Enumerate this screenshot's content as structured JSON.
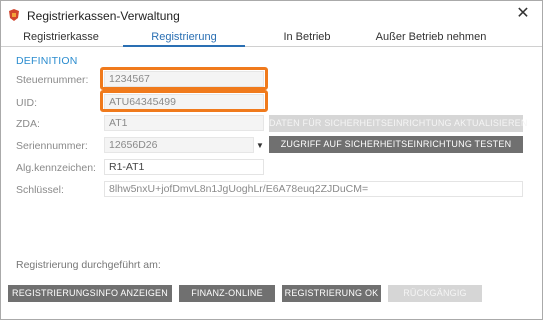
{
  "window": {
    "title": "Registrierkassen-Verwaltung",
    "close_glyph": "✕"
  },
  "tabs": [
    {
      "label": "Registrierkasse",
      "active": false
    },
    {
      "label": "Registrierung",
      "active": true
    },
    {
      "label": "In Betrieb",
      "active": false
    },
    {
      "label": "Außer Betrieb nehmen",
      "active": false
    }
  ],
  "definition": {
    "section_title": "DEFINITION",
    "steuernummer_label": "Steuernummer:",
    "steuernummer_value": "1234567",
    "uid_label": "UID:",
    "uid_value": "ATU64345499",
    "zda_label": "ZDA:",
    "zda_value": "AT1",
    "seriennummer_label": "Seriennummer:",
    "seriennummer_value": "12656D26",
    "algkennzeichen_label": "Alg.kennzeichen:",
    "algkennzeichen_value": "R1-AT1",
    "schluessel_label": "Schlüssel:",
    "schluessel_value": "8lhw5nxU+jofDmvL8n1JgUoghLr/E6A78euq2ZJDuCM="
  },
  "buttons": {
    "update_security": "DATEN FÜR SICHERHEITSEINRICHTUNG AKTUALISIEREN",
    "test_access": "ZUGRIFF AUF SICHERHEITSEINRICHTUNG TESTEN",
    "registration_info": "REGISTRIERUNGSINFO ANZEIGEN",
    "finanz_online": "FINANZ-ONLINE",
    "registration_ok": "REGISTRIERUNG OK",
    "undo": "RÜCKGÄNGIG"
  },
  "footer": {
    "registration_done_label": "Registrierung durchgeführt am:"
  },
  "colors": {
    "accent": "#2a6fb3",
    "highlight": "#f07a1c",
    "button": "#707070",
    "button_disabled": "#d6d6d6"
  },
  "icons": {
    "app": "app-logo-icon",
    "close": "close-icon",
    "dropdown": "chevron-down-icon"
  }
}
